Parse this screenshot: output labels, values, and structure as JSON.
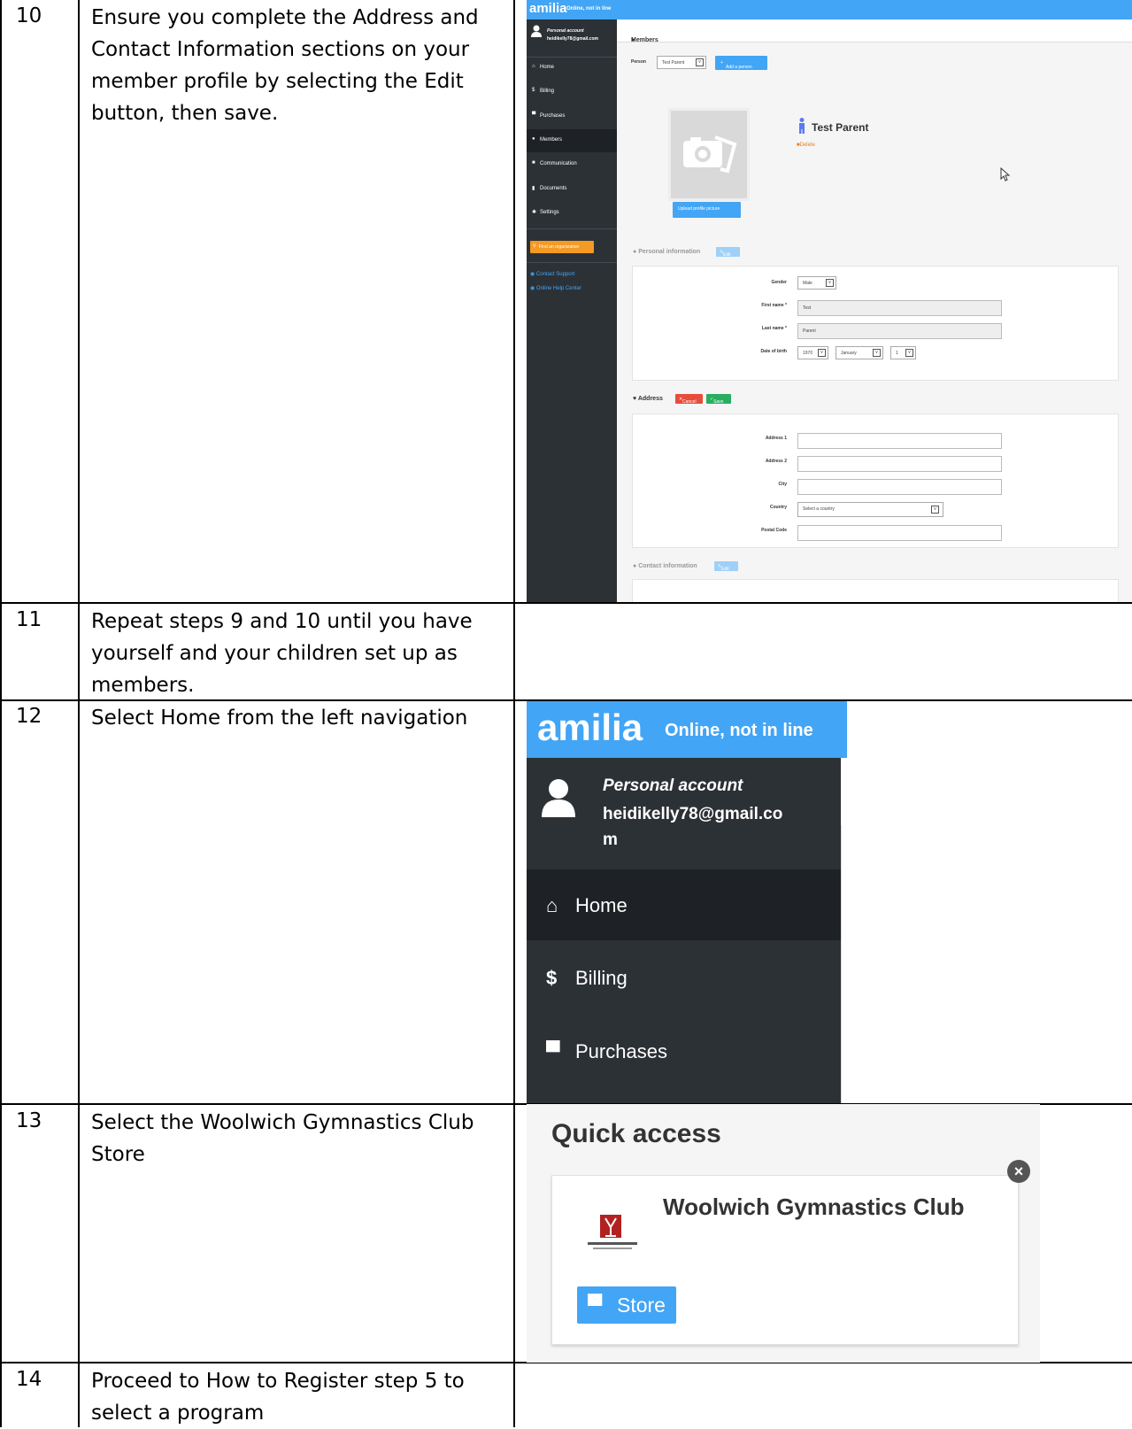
{
  "rows": [
    {
      "num": "10",
      "text": "Ensure you complete the Address and Contact Information sections on your member profile by selecting the Edit button, then save."
    },
    {
      "num": "11",
      "text": "Repeat steps 9 and 10 until you have yourself and your children set up as members."
    },
    {
      "num": "12",
      "text": "Select Home from the left navigation"
    },
    {
      "num": "13",
      "text": "Select the Woolwich Gymnastics Club Store"
    },
    {
      "num": "14",
      "text": "Proceed to How to Register step 5 to select a program"
    }
  ],
  "app": {
    "brand": "amilia",
    "tagline": "Online, not in line",
    "brand_color": "#42a5f5",
    "sidebar_color": "#2c3136",
    "account_label": "Personal account",
    "account_email": "heidikelly78@gmail.com",
    "nav": {
      "home": "Home",
      "billing": "Billing",
      "purchases": "Purchases",
      "members": "Members",
      "communication": "Communication",
      "documents": "Documents",
      "settings": "Settings"
    },
    "find_org": "Find an organization",
    "contact_support": "Contact Support",
    "help_center": "Online Help Center"
  },
  "members_page": {
    "header": "Members",
    "person_label": "Person",
    "person_value": "Test Parent",
    "add_person": "Add a person",
    "profile_name": "Test Parent",
    "delete": "Delete",
    "upload_picture": "Upload profile picture",
    "personal_info": {
      "title": "Personal information",
      "edit": "Edit",
      "gender_label": "Gender",
      "gender_value": "Male",
      "first_name_label": "First name *",
      "first_name_value": "Test",
      "last_name_label": "Last name *",
      "last_name_value": "Parent",
      "dob_label": "Date of birth",
      "dob_year": "1970",
      "dob_month": "January",
      "dob_day": "1"
    },
    "address": {
      "title": "Address",
      "cancel": "Cancel",
      "save": "Save",
      "address1_label": "Address 1",
      "address2_label": "Address 2",
      "city_label": "City",
      "country_label": "Country",
      "country_placeholder": "Select a country",
      "postal_label": "Postal Code"
    },
    "contact_info": {
      "title": "Contact information",
      "edit": "Edit"
    }
  },
  "quick_access": {
    "title": "Quick access",
    "club_name": "Woolwich Gymnastics Club",
    "store": "Store"
  }
}
